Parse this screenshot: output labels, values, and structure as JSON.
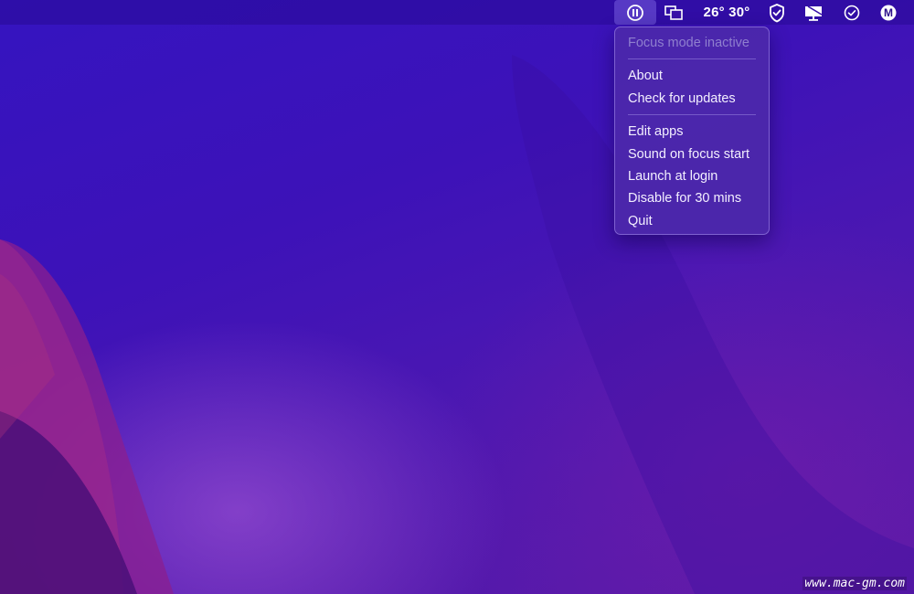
{
  "menubar": {
    "weather_text": "26° 30°",
    "icons": {
      "focus": "pause-circle-icon",
      "windows": "overlapping-windows-icon",
      "vpn": "shield-check-icon",
      "display": "monitor-icon",
      "tasks": "check-circle-icon",
      "app": "m-logo-icon"
    },
    "app_letter": "M"
  },
  "menu": {
    "status": "Focus mode inactive",
    "group1": [
      "About",
      "Check for updates"
    ],
    "group2": [
      "Edit apps",
      "Sound on focus start",
      "Launch at login",
      "Disable for 30 mins",
      "Quit"
    ]
  },
  "watermark": "www.mac-gm.com",
  "colors": {
    "wallpaper": "#3a11b5",
    "menu_bg": "#4c28aa",
    "menu_text": "#f3efff",
    "disabled_text": "#8f7fcf"
  }
}
